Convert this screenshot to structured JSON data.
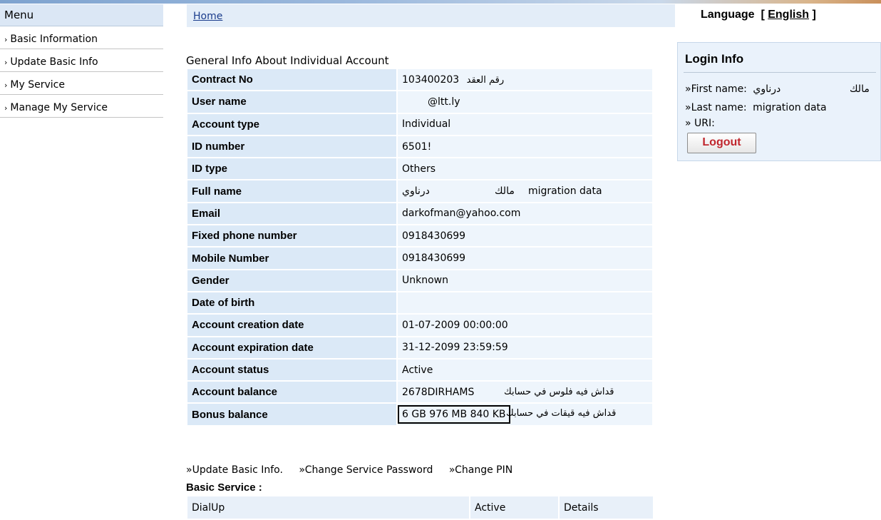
{
  "menu": {
    "title": "Menu",
    "items": [
      {
        "label": "Basic Information"
      },
      {
        "label": "Update Basic Info"
      },
      {
        "label": "My Service"
      },
      {
        "label": "Manage My Service"
      }
    ]
  },
  "breadcrumb": {
    "home": "Home"
  },
  "language": {
    "label": "Language",
    "bracket_open": "[",
    "current": "English",
    "bracket_close": "]"
  },
  "login": {
    "title": "Login Info",
    "first_name_label": "»First name:",
    "first_name_value": "درناوي",
    "first_name_value2": "مالك",
    "last_name_label": "»Last name:",
    "last_name_value": "migration data",
    "uri_label": "» URI:",
    "logout": "Logout"
  },
  "account": {
    "section_title": "General Info About Individual Account",
    "rows": [
      {
        "label": "Contract No",
        "value": "103400203",
        "extra": "رقم العقد"
      },
      {
        "label": "User name",
        "value": "@ltt.ly",
        "extra": ""
      },
      {
        "label": "Account type",
        "value": "Individual",
        "extra": ""
      },
      {
        "label": "ID number",
        "value": "6501!",
        "extra": ""
      },
      {
        "label": "ID type",
        "value": "Others",
        "extra": ""
      },
      {
        "label": "Full name",
        "value": "درناوي",
        "extra": "مالك",
        "extra2": "migration data"
      },
      {
        "label": "Email",
        "value": "darkofman@yahoo.com",
        "extra": ""
      },
      {
        "label": "Fixed phone number",
        "value": "0918430699",
        "extra": ""
      },
      {
        "label": "Mobile Number",
        "value": "0918430699",
        "extra": ""
      },
      {
        "label": "Gender",
        "value": "Unknown",
        "extra": ""
      },
      {
        "label": "Date of birth",
        "value": "",
        "extra": ""
      },
      {
        "label": "Account creation date",
        "value": "01-07-2009 00:00:00",
        "extra": ""
      },
      {
        "label": "Account expiration date",
        "value": "31-12-2099 23:59:59",
        "extra": ""
      },
      {
        "label": "Account status",
        "value": "Active",
        "extra": ""
      },
      {
        "label": "Account balance",
        "value": "2678DIRHAMS",
        "extra": "قداش فيه فلوس في حسابك"
      },
      {
        "label": "Bonus balance",
        "value": "6 GB 976 MB 840 KB",
        "extra": "قداش فيه قيقات في حسابك"
      }
    ]
  },
  "actions": [
    {
      "label": "»Update Basic Info."
    },
    {
      "label": "»Change Service Password"
    },
    {
      "label": "»Change PIN"
    }
  ],
  "basic_service": {
    "title": "Basic Service :",
    "rows": [
      {
        "name": "DialUp",
        "status": "Active",
        "details": "Details"
      }
    ]
  }
}
